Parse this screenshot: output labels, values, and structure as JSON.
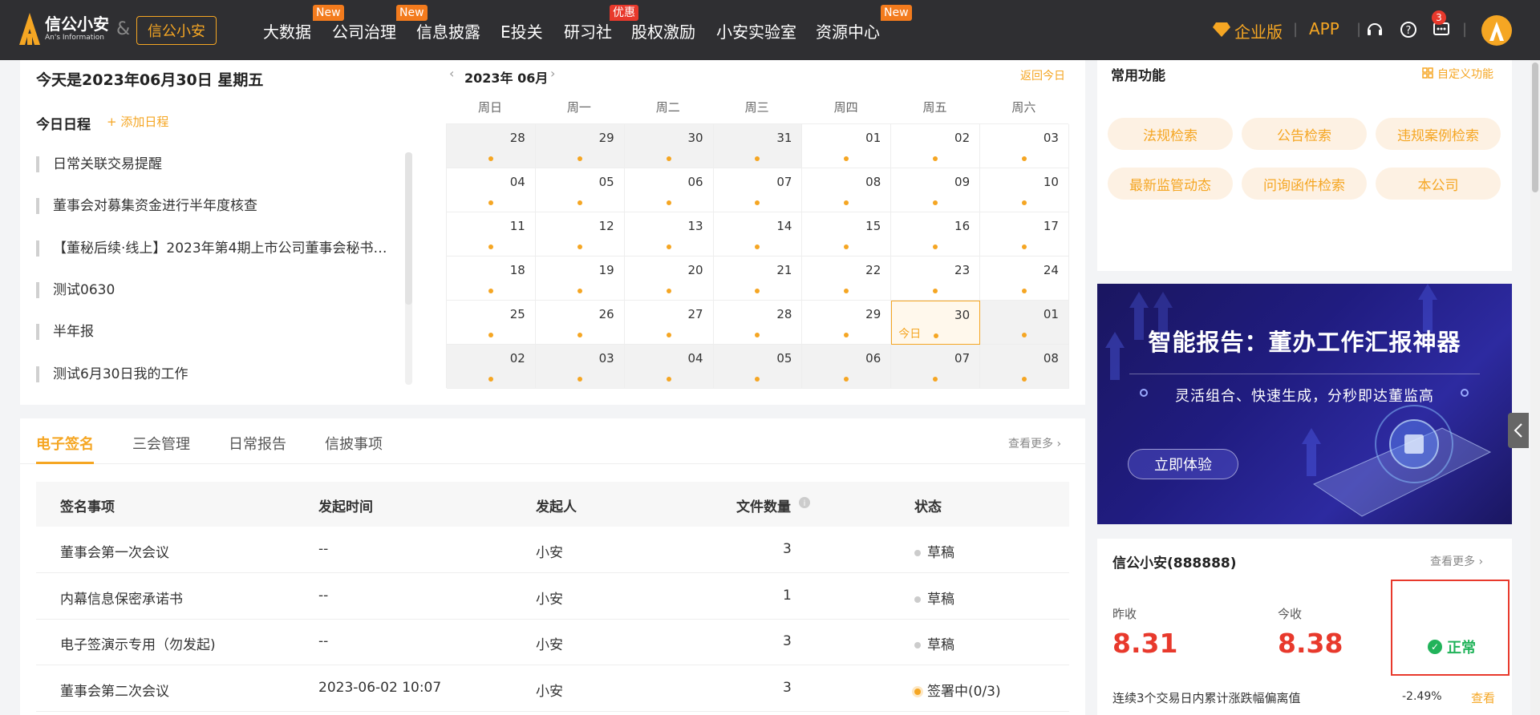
{
  "header": {
    "logo_cn": "信公小安",
    "logo_en": "An's Information",
    "amp": "&",
    "partner_badge": "信公小安",
    "nav": [
      {
        "label": "大数据",
        "tag": "New"
      },
      {
        "label": "公司治理",
        "tag": "New"
      },
      {
        "label": "信息披露",
        "tag": ""
      },
      {
        "label": "E投关",
        "tag": ""
      },
      {
        "label": "研习社",
        "tag": "优惠"
      },
      {
        "label": "股权激励",
        "tag": ""
      },
      {
        "label": "小安实验室",
        "tag": ""
      },
      {
        "label": "资源中心",
        "tag": "New"
      }
    ],
    "enterprise": "企业版",
    "sep": "|",
    "app": "APP",
    "msg_count": "3"
  },
  "schedule": {
    "today": "今天是2023年06月30日 星期五",
    "title": "今日日程",
    "add": "+ 添加日程",
    "items": [
      "日常关联交易提醒",
      "董事会对募集资金进行半年度核查",
      "【董秘后续·线上】2023年第4期上市公司董事会秘书…",
      "测试0630",
      "半年报",
      "测试6月30日我的工作"
    ]
  },
  "calendar": {
    "month": "2023年 06月",
    "prev": "‹",
    "next": "›",
    "back_today": "返回今日",
    "weekdays": [
      "周日",
      "周一",
      "周二",
      "周三",
      "周四",
      "周五",
      "周六"
    ],
    "today_label": "今日",
    "days": [
      [
        "28",
        "29",
        "30",
        "31",
        "01",
        "02",
        "03"
      ],
      [
        "04",
        "05",
        "06",
        "07",
        "08",
        "09",
        "10"
      ],
      [
        "11",
        "12",
        "13",
        "14",
        "15",
        "16",
        "17"
      ],
      [
        "18",
        "19",
        "20",
        "21",
        "22",
        "23",
        "24"
      ],
      [
        "25",
        "26",
        "27",
        "28",
        "29",
        "30",
        "01"
      ],
      [
        "02",
        "03",
        "04",
        "05",
        "06",
        "07",
        "08"
      ]
    ]
  },
  "sign": {
    "tabs": [
      "电子签名",
      "三会管理",
      "日常报告",
      "信披事项"
    ],
    "more": "查看更多 ›",
    "columns": [
      "签名事项",
      "发起时间",
      "发起人",
      "文件数量",
      "状态"
    ],
    "rows": [
      {
        "name": "董事会第一次会议",
        "time": "--",
        "initiator": "小安",
        "count": "3",
        "status": "草稿"
      },
      {
        "name": "内幕信息保密承诺书",
        "time": "--",
        "initiator": "小安",
        "count": "1",
        "status": "草稿"
      },
      {
        "name": "电子签演示专用（勿发起)",
        "time": "--",
        "initiator": "小安",
        "count": "3",
        "status": "草稿"
      },
      {
        "name": "董事会第二次会议",
        "time": "2023-06-02 10:07",
        "initiator": "小安",
        "count": "3",
        "status": "签署中(0/3)"
      }
    ]
  },
  "functions": {
    "title": "常用功能",
    "custom": "自定义功能",
    "items": [
      "法规检索",
      "公告检索",
      "违规案例检索",
      "最新监管动态",
      "问询函件检索",
      "本公司"
    ]
  },
  "banner": {
    "title": "智能报告：董办工作汇报神器",
    "subtitle": "灵活组合、快速生成，分秒即达董监高",
    "button": "立即体验"
  },
  "stock": {
    "title": "信公小安(888888)",
    "more": "查看更多 ›",
    "prev_close_label": "昨收",
    "prev_close": "8.31",
    "today_label": "今收",
    "today": "8.38",
    "status": "正常",
    "footnote": "连续3个交易日内累计涨跌幅偏离值",
    "pct": "-2.49%",
    "view": "查看"
  },
  "colors": {
    "accent": "#f5a623",
    "danger": "#e8392c",
    "ok": "#21b35a",
    "topbar": "#2f2f32"
  }
}
